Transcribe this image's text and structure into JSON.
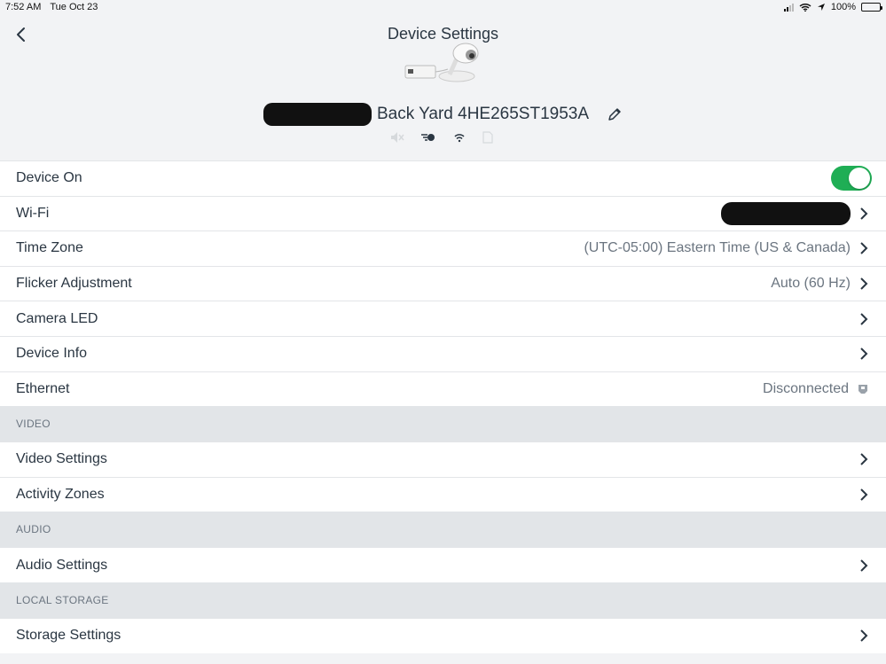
{
  "status_bar": {
    "time": "7:52 AM",
    "date": "Tue Oct 23",
    "battery": "100%"
  },
  "header": {
    "title": "Device Settings",
    "device_name": "Back Yard 4HE265ST1953A"
  },
  "rows_top": [
    {
      "label": "Device On",
      "type": "toggle",
      "on": true
    },
    {
      "label": "Wi-Fi",
      "type": "redacted"
    },
    {
      "label": "Time Zone",
      "value": "(UTC-05:00) Eastern Time (US & Canada)"
    },
    {
      "label": "Flicker Adjustment",
      "value": "Auto (60 Hz)"
    },
    {
      "label": "Camera LED",
      "value": ""
    },
    {
      "label": "Device Info",
      "value": ""
    },
    {
      "label": "Ethernet",
      "value": "Disconnected"
    }
  ],
  "sections": {
    "video": {
      "title": "VIDEO",
      "items": [
        "Video Settings",
        "Activity Zones"
      ]
    },
    "audio": {
      "title": "AUDIO",
      "items": [
        "Audio Settings"
      ]
    },
    "storage": {
      "title": "LOCAL STORAGE",
      "items": [
        "Storage Settings"
      ]
    }
  },
  "colors": {
    "toggle_on": "#1fae55",
    "text": "#2a3642",
    "muted": "#6b7580",
    "section_bg": "#e2e5e8"
  },
  "icons": [
    "back-chevron-icon",
    "pencil-icon",
    "speaker-muted-icon",
    "motion-icon",
    "wifi-icon",
    "sd-card-icon",
    "chevron-right-icon",
    "ethernet-icon"
  ]
}
